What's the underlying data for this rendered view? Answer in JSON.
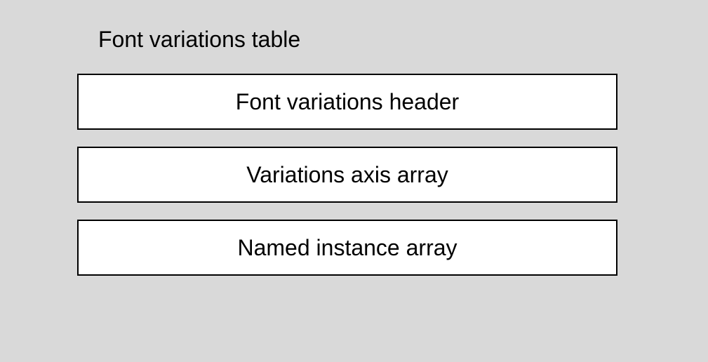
{
  "title": "Font variations table",
  "boxes": [
    {
      "label": "Font variations header"
    },
    {
      "label": "Variations axis array"
    },
    {
      "label": "Named instance array"
    }
  ]
}
